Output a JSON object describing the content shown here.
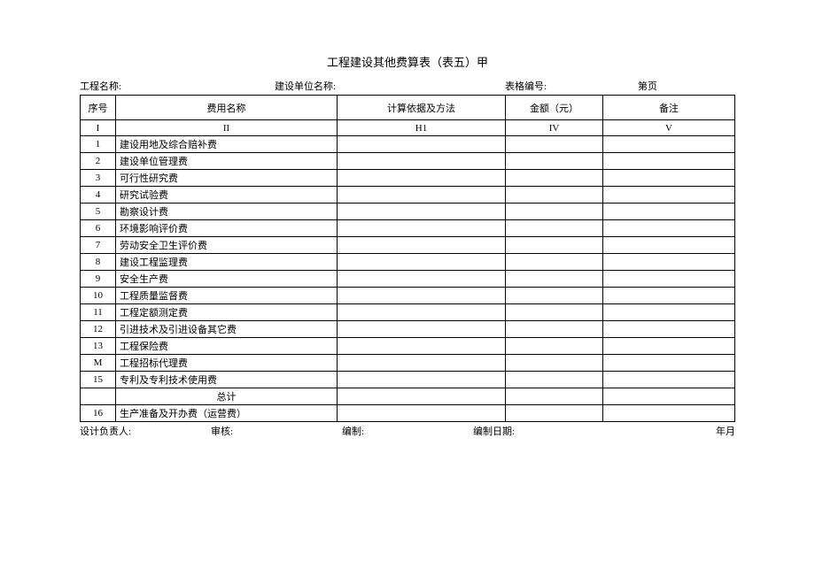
{
  "title": "工程建设其他费算表（表五）甲",
  "meta": {
    "projectLabel": "工程名称:",
    "unitLabel": "建设单位名称:",
    "formNoLabel": "表格编号:",
    "pageLabel": "第页"
  },
  "header": {
    "seq": "序号",
    "name": "费用名称",
    "calc": "计算依据及方法",
    "amount": "金额（元）",
    "note": "备注"
  },
  "header2": {
    "seq": "I",
    "name": "II",
    "calc": "H1",
    "amount": "IV",
    "note": "V"
  },
  "rows": [
    {
      "seq": "1",
      "name": "建设用地及综合赔补费"
    },
    {
      "seq": "2",
      "name": "建设单位管理费"
    },
    {
      "seq": "3",
      "name": "可行性研究费"
    },
    {
      "seq": "4",
      "name": "研究试验费"
    },
    {
      "seq": "5",
      "name": "勘察设计费"
    },
    {
      "seq": "6",
      "name": "环境影响评价费"
    },
    {
      "seq": "7",
      "name": "劳动安全卫生评价费"
    },
    {
      "seq": "8",
      "name": "建设工程监理费"
    },
    {
      "seq": "9",
      "name": "安全生产费"
    },
    {
      "seq": "10",
      "name": "工程质量监督费"
    },
    {
      "seq": "11",
      "name": "工程定额测定费"
    },
    {
      "seq": "12",
      "name": "引进技术及引进设备其它费"
    },
    {
      "seq": "13",
      "name": "工程保险费"
    },
    {
      "seq": "M",
      "name": "工程招标代理费"
    },
    {
      "seq": "15",
      "name": "专利及专利技术使用费"
    },
    {
      "seq": "",
      "name": "总计"
    },
    {
      "seq": "16",
      "name": "生产准备及开办费（运营费）"
    }
  ],
  "footer": {
    "designer": "设计负责人:",
    "reviewer": "审核:",
    "compiler": "编制:",
    "dateLabel": "编制日期:",
    "yearmonth": "年月"
  }
}
